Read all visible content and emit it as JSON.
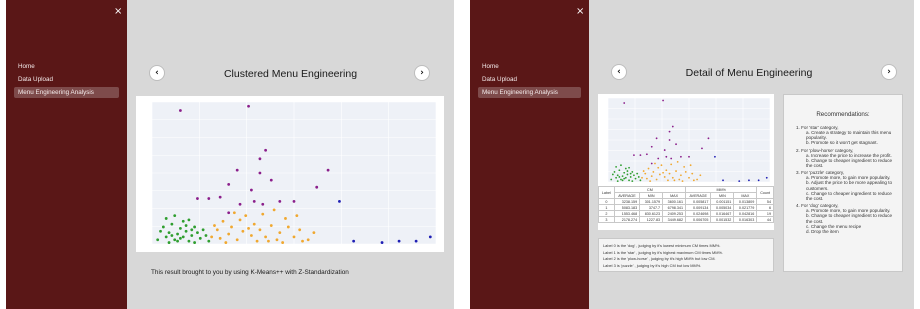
{
  "sidebar": {
    "close_icon": "×",
    "items": [
      {
        "label": "Home",
        "active": false
      },
      {
        "label": "Data Upload",
        "active": false
      },
      {
        "label": "Menu Engineering Analysis",
        "active": true
      }
    ]
  },
  "left": {
    "title": "Clustered Menu Engineering",
    "prev_icon": "‹",
    "next_icon": "›",
    "caption": "This result brought to you by using K-Means++ with Z-Standardization"
  },
  "right": {
    "title": "Detail of Menu Engineering",
    "prev_icon": "‹",
    "next_icon": "›",
    "table": {
      "corner": "Label",
      "group_cm": "CM",
      "group_mm": "MM%",
      "count": "Count",
      "sub": [
        "AVERAGE",
        "MIN",
        "MAX",
        "AVERAGE",
        "MIN",
        "MAX"
      ],
      "rows": [
        [
          "0",
          "3238.159",
          "301.1579",
          "3600.161",
          "0.005817",
          "0.001151",
          "0.013809",
          "54"
        ],
        [
          "1",
          "5083.183",
          "3747.7",
          "6798.341",
          "0.009134",
          "0.005034",
          "0.021779",
          "6"
        ],
        [
          "2",
          "1553.468",
          "830.6123",
          "2409.253",
          "0.024698",
          "0.016467",
          "0.042816",
          "19"
        ],
        [
          "3",
          "2178.274",
          "1227.83",
          "3449.682",
          "0.006705",
          "0.001532",
          "0.016303",
          "44"
        ]
      ]
    },
    "labels": [
      "Label 0 is the 'dog' , judging by it's lowest minimum CM times MM%.",
      "Label 1 is the 'star' , judging by it's highest maximum CM times MM%.",
      "Label 2 is the 'plow-horse' , judging by it's high MM% but low CM.",
      "Label 3 is 'puzzle' , judging by it's high CM but low MM%."
    ],
    "recommendations": {
      "title": "Recommendations:",
      "categories": [
        {
          "head": "1. For 'star' category,",
          "items": [
            "a. Create a strategy to maintain this menu",
            "popularity.",
            "b. Promote so it won't get stagnant."
          ]
        },
        {
          "head": "2. For 'plow-horse' category,",
          "items": [
            "a. Increase the price to increase the profit.",
            "b. Change to cheaper ingredient to reduce",
            "the cost."
          ]
        },
        {
          "head": "3. For 'puzzle' category,",
          "items": [
            "a. Promote more, to gain more popularity.",
            "b. Adjust the price to be more appealing to",
            "customers.",
            "c. Change to cheaper ingredient to reduce",
            "the cost."
          ]
        },
        {
          "head": "4. For 'dog' category,",
          "items": [
            "a. Promote more, to gain more popularity.",
            "b. Change to cheaper ingredient to reduce",
            "the cost.",
            "c. Change the menu recipe",
            "d. Drop the item"
          ]
        }
      ]
    }
  },
  "colors": {
    "sidebar": "#5a1717",
    "main_bg": "#d8d8d8",
    "cluster_0": "#2f9e2f",
    "cluster_1": "#1f1fb4",
    "cluster_2": "#8b1f8b",
    "cluster_3": "#f0a830"
  },
  "chart_data": {
    "type": "scatter",
    "title": "",
    "xlabel": "",
    "ylabel": "",
    "grid": true,
    "legend": "none",
    "series": [
      {
        "color": "#2f9e2f",
        "points": [
          [
            0.02,
            0.03
          ],
          [
            0.04,
            0.12
          ],
          [
            0.05,
            0.05
          ],
          [
            0.06,
            0.08
          ],
          [
            0.07,
            0.14
          ],
          [
            0.08,
            0.03
          ],
          [
            0.09,
            0.07
          ],
          [
            0.1,
            0.11
          ],
          [
            0.11,
            0.05
          ],
          [
            0.12,
            0.09
          ],
          [
            0.13,
            0.02
          ],
          [
            0.14,
            0.06
          ],
          [
            0.15,
            0.12
          ],
          [
            0.16,
            0.08
          ],
          [
            0.17,
            0.04
          ],
          [
            0.18,
            0.1
          ],
          [
            0.19,
            0.06
          ],
          [
            0.2,
            0.02
          ],
          [
            0.05,
            0.18
          ],
          [
            0.08,
            0.2
          ],
          [
            0.11,
            0.16
          ],
          [
            0.13,
            0.17
          ],
          [
            0.06,
            0.01
          ],
          [
            0.09,
            0.02
          ],
          [
            0.15,
            0.01
          ],
          [
            0.03,
            0.09
          ],
          [
            0.07,
            0.06
          ],
          [
            0.1,
            0.04
          ],
          [
            0.12,
            0.13
          ],
          [
            0.14,
            0.1
          ]
        ]
      },
      {
        "color": "#f0a830",
        "points": [
          [
            0.21,
            0.05
          ],
          [
            0.23,
            0.1
          ],
          [
            0.25,
            0.16
          ],
          [
            0.27,
            0.07
          ],
          [
            0.28,
            0.12
          ],
          [
            0.3,
            0.03
          ],
          [
            0.32,
            0.09
          ],
          [
            0.33,
            0.2
          ],
          [
            0.35,
            0.06
          ],
          [
            0.36,
            0.14
          ],
          [
            0.37,
            0.02
          ],
          [
            0.38,
            0.1
          ],
          [
            0.4,
            0.05
          ],
          [
            0.42,
            0.13
          ],
          [
            0.44,
            0.03
          ],
          [
            0.45,
            0.08
          ],
          [
            0.47,
            0.18
          ],
          [
            0.5,
            0.05
          ],
          [
            0.52,
            0.1
          ],
          [
            0.55,
            0.03
          ],
          [
            0.29,
            0.22
          ],
          [
            0.31,
            0.17
          ],
          [
            0.34,
            0.11
          ],
          [
            0.39,
            0.21
          ],
          [
            0.26,
            0.01
          ],
          [
            0.24,
            0.04
          ],
          [
            0.41,
            0.02
          ],
          [
            0.48,
            0.12
          ],
          [
            0.53,
            0.02
          ],
          [
            0.22,
            0.13
          ],
          [
            0.43,
            0.24
          ],
          [
            0.46,
            0.01
          ],
          [
            0.51,
            0.2
          ],
          [
            0.57,
            0.08
          ]
        ]
      },
      {
        "color": "#8b1f8b",
        "points": [
          [
            0.1,
            0.94
          ],
          [
            0.34,
            0.97
          ],
          [
            0.38,
            0.6
          ],
          [
            0.38,
            0.5
          ],
          [
            0.4,
            0.66
          ],
          [
            0.3,
            0.52
          ],
          [
            0.27,
            0.42
          ],
          [
            0.35,
            0.38
          ],
          [
            0.42,
            0.45
          ],
          [
            0.2,
            0.32
          ],
          [
            0.24,
            0.33
          ],
          [
            0.31,
            0.28
          ],
          [
            0.36,
            0.3
          ],
          [
            0.39,
            0.28
          ],
          [
            0.16,
            0.32
          ],
          [
            0.58,
            0.4
          ],
          [
            0.62,
            0.52
          ],
          [
            0.5,
            0.3
          ],
          [
            0.27,
            0.22
          ],
          [
            0.45,
            0.3
          ]
        ]
      },
      {
        "color": "#1f1fb4",
        "points": [
          [
            0.66,
            0.3
          ],
          [
            0.71,
            0.02
          ],
          [
            0.81,
            0.01
          ],
          [
            0.87,
            0.02
          ],
          [
            0.93,
            0.02
          ],
          [
            0.98,
            0.05
          ]
        ]
      }
    ]
  }
}
